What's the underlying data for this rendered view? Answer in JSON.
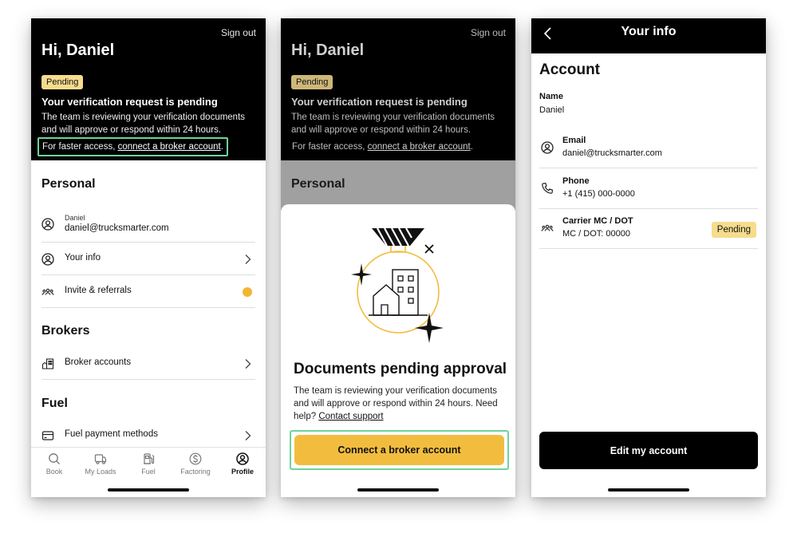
{
  "profile": {
    "sign_out": "Sign out",
    "greeting": "Hi, Daniel",
    "badge": "Pending",
    "verification_title": "Your verification request is pending",
    "verification_desc": "The team is reviewing your verification documents and will approve or respond within 24 hours.",
    "faster_prefix": "For faster access, ",
    "faster_link": "connect a broker account",
    "faster_suffix": ".",
    "personal_heading": "Personal",
    "account_name_small": "Daniel",
    "account_email": "daniel@trucksmarter.com",
    "your_info": "Your info",
    "invite": "Invite & referrals",
    "brokers_heading": "Brokers",
    "broker_accounts": "Broker accounts",
    "fuel_heading": "Fuel",
    "fuel_payment": "Fuel payment methods",
    "accent_color": "#f2b632",
    "highlight_color": "#6fd39a"
  },
  "tabs": [
    {
      "label": "Book",
      "icon": "search-icon"
    },
    {
      "label": "My Loads",
      "icon": "truck-icon"
    },
    {
      "label": "Fuel",
      "icon": "fuel-pump-icon"
    },
    {
      "label": "Factoring",
      "icon": "dollar-circle-icon"
    },
    {
      "label": "Profile",
      "icon": "user-circle-icon",
      "active": true
    }
  ],
  "sheet": {
    "title": "Documents pending approval",
    "desc_prefix": "The team is reviewing your verification documents and will approve or respond within 24 hours. Need help? ",
    "contact_link": "Contact support",
    "cta": "Connect a broker account"
  },
  "your_info": {
    "title": "Your info",
    "heading": "Account",
    "name_label": "Name",
    "name_value": "Daniel",
    "email_label": "Email",
    "email_value": "daniel@trucksmarter.com",
    "phone_label": "Phone",
    "phone_value": "+1 (415) 000-0000",
    "carrier_label": "Carrier MC / DOT",
    "carrier_value": "MC / DOT: 00000",
    "carrier_badge": "Pending",
    "edit_button": "Edit my account"
  }
}
